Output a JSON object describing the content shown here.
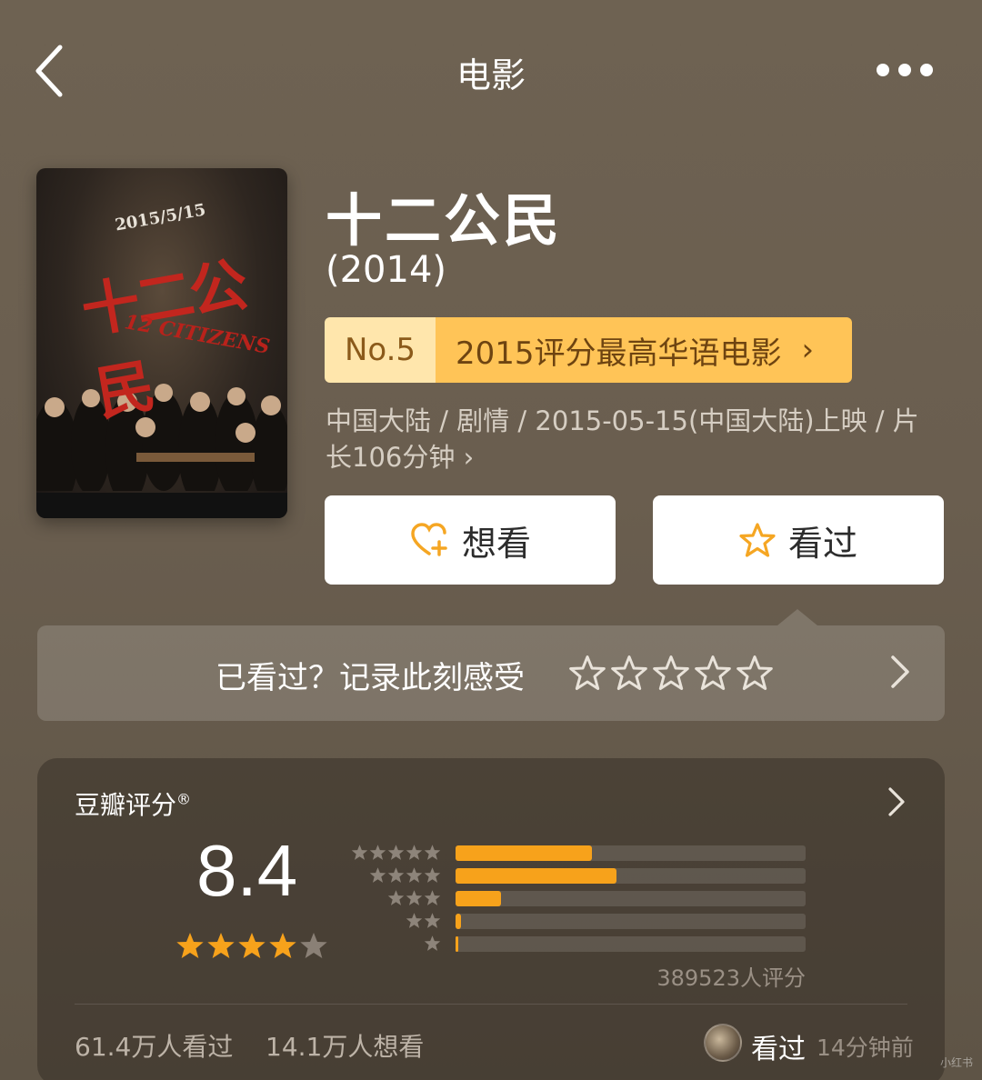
{
  "nav": {
    "title": "电影"
  },
  "poster": {
    "title_cn": "十二公民",
    "title_en": "12 CITIZENS",
    "date_text": "2015/5/15"
  },
  "movie": {
    "title": "十二公民",
    "year": "(2014)",
    "rank_no": "No.5",
    "rank_text": "2015评分最高华语电影",
    "rank_arrow": "›",
    "info": "中国大陆 / 剧情 / 2015-05-15(中国大陆)上映 / 片长106分钟 ›"
  },
  "actions": {
    "want": "想看",
    "seen": "看过"
  },
  "record": {
    "text": "已看过？记录此刻感受",
    "stars": 5
  },
  "rating": {
    "label": "豆瓣评分",
    "mark": "®",
    "score": "8.4",
    "stars": 4,
    "distribution": [
      {
        "stars": 5,
        "percent": 39
      },
      {
        "stars": 4,
        "percent": 46
      },
      {
        "stars": 3,
        "percent": 13
      },
      {
        "stars": 2,
        "percent": 1.5
      },
      {
        "stars": 1,
        "percent": 0.8
      }
    ],
    "count_text": "389523人评分"
  },
  "stats": {
    "seen": "61.4万人看过",
    "want": "14.1万人想看"
  },
  "friend": {
    "action": "看过",
    "time": "14分钟前"
  },
  "watermark": "小红书",
  "colors": {
    "accent": "#f7a21b",
    "rank_bg": "#ffc457",
    "rank_no_bg": "#ffe6ac",
    "background": "#6e6252"
  }
}
